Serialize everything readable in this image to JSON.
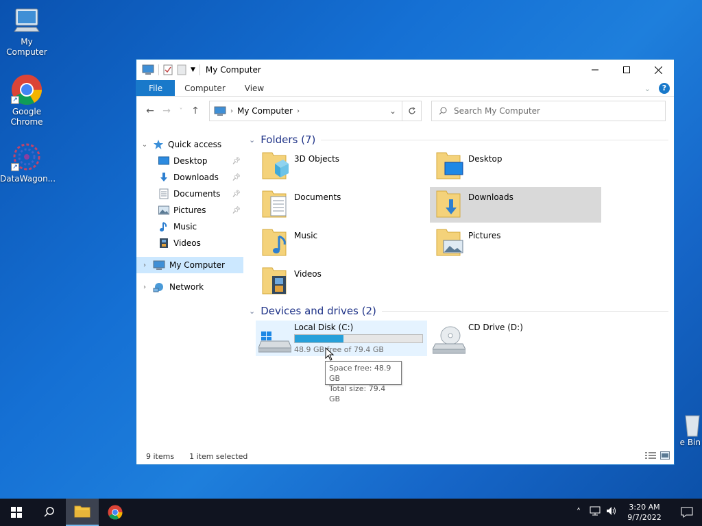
{
  "desktop": {
    "icons": [
      {
        "label": "My Computer"
      },
      {
        "label": "Google\nChrome"
      },
      {
        "label": "DataWagon..."
      }
    ],
    "recycle_bin_label": "e Bin"
  },
  "window": {
    "title": "My Computer",
    "ribbon_tabs": [
      "File",
      "Computer",
      "View"
    ],
    "address": {
      "crumb": "My Computer"
    },
    "search": {
      "placeholder": "Search My Computer"
    },
    "nav_pane": {
      "quick_access": "Quick access",
      "items": [
        {
          "label": "Desktop",
          "pinned": true
        },
        {
          "label": "Downloads",
          "pinned": true
        },
        {
          "label": "Documents",
          "pinned": true
        },
        {
          "label": "Pictures",
          "pinned": true
        },
        {
          "label": "Music",
          "pinned": false
        },
        {
          "label": "Videos",
          "pinned": false
        }
      ],
      "my_computer": "My Computer",
      "network": "Network"
    },
    "folders_header": "Folders (7)",
    "folders": [
      {
        "name": "3D Objects"
      },
      {
        "name": "Desktop"
      },
      {
        "name": "Documents"
      },
      {
        "name": "Downloads"
      },
      {
        "name": "Music"
      },
      {
        "name": "Pictures"
      },
      {
        "name": "Videos"
      }
    ],
    "devices_header": "Devices and drives (2)",
    "drives": [
      {
        "name": "Local Disk (C:)",
        "free_text": "48.9 GB free of 79.4 GB",
        "used_fraction": 0.384
      },
      {
        "name": "CD Drive (D:)"
      }
    ],
    "tooltip": {
      "line1": "Space free: 48.9 GB",
      "line2": "Total size: 79.4 GB"
    },
    "status": {
      "items": "9 items",
      "selected": "1 item selected"
    }
  },
  "taskbar": {
    "time": "3:20 AM",
    "date": "9/7/2022"
  },
  "colors": {
    "accent": "#1979ca",
    "drive_fill": "#26a0da",
    "selection": "#cce8ff"
  }
}
